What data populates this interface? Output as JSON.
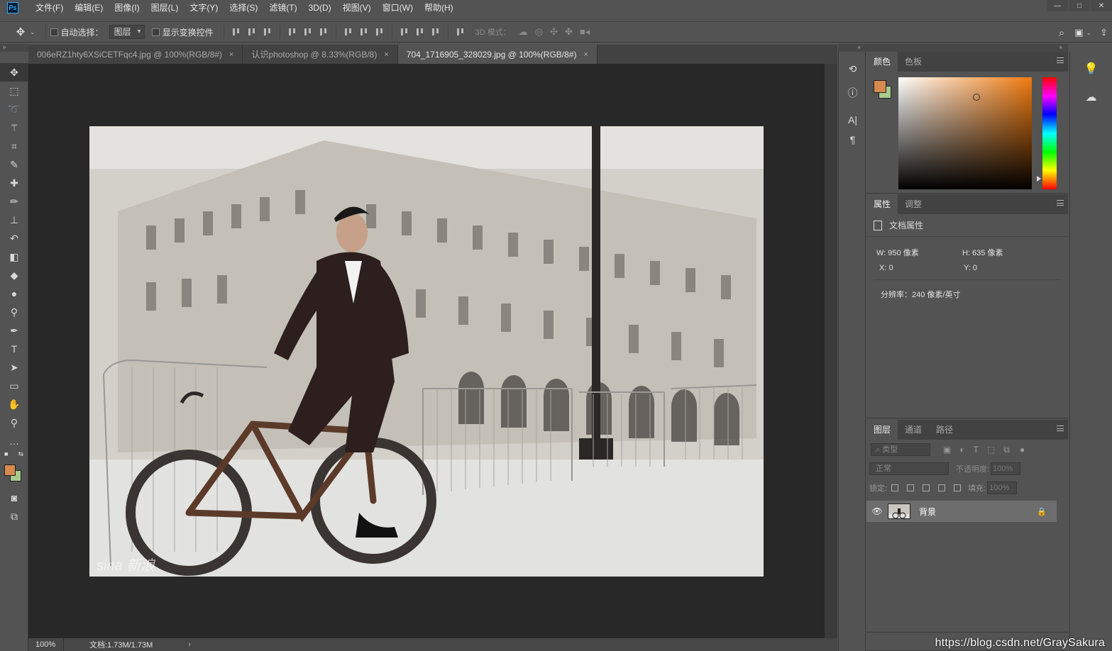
{
  "app": {
    "logo": "Ps"
  },
  "menu": [
    "文件(F)",
    "编辑(E)",
    "图像(I)",
    "图层(L)",
    "文字(Y)",
    "选择(S)",
    "滤镜(T)",
    "3D(D)",
    "视图(V)",
    "窗口(W)",
    "帮助(H)"
  ],
  "window_controls": {
    "minimize": "—",
    "maximize": "□",
    "close": "✕"
  },
  "options": {
    "auto_select_label": "自动选择：",
    "auto_select_value": "图层",
    "show_transform_label": "显示变换控件",
    "mode_3d_label": "3D 模式："
  },
  "tabs": [
    {
      "label": "006eRZ1hty6XSiCETFqc4.jpg @ 100%(RGB/8#)",
      "close": "×"
    },
    {
      "label": "认识photoshop @ 8.33%(RGB/8)",
      "close": "×"
    },
    {
      "label": "704_1716905_328029.jpg @ 100%(RGB/8#)",
      "close": "×"
    }
  ],
  "status": {
    "zoom": "100%",
    "doc": "文档:1.73M/1.73M",
    "arrow": "›"
  },
  "colors": {
    "foreground": "#d7894f",
    "background": "#a7cc8c"
  },
  "color_panel": {
    "tabs": [
      "颜色",
      "色板"
    ]
  },
  "properties_panel": {
    "tabs": [
      "属性",
      "调整"
    ],
    "title": "文档属性",
    "w": "W:  950 像素",
    "h": "H:  635 像素",
    "x": "X:  0",
    "y": "Y:  0",
    "resolution": "分辨率：240 像素/英寸"
  },
  "layers_panel": {
    "tabs": [
      "图层",
      "通道",
      "路径"
    ],
    "filter_placeholder": "类型",
    "blend_mode": "正常",
    "opacity_label": "不透明度:",
    "opacity_value": "100%",
    "lock_label": "锁定:",
    "fill_label": "填充:",
    "fill_value": "100%",
    "layers": [
      {
        "name": "背景",
        "visible": true,
        "locked": true
      }
    ]
  },
  "photo": {
    "watermark": "sina 新浪"
  },
  "blog_watermark": "https://blog.csdn.net/GraySakura"
}
